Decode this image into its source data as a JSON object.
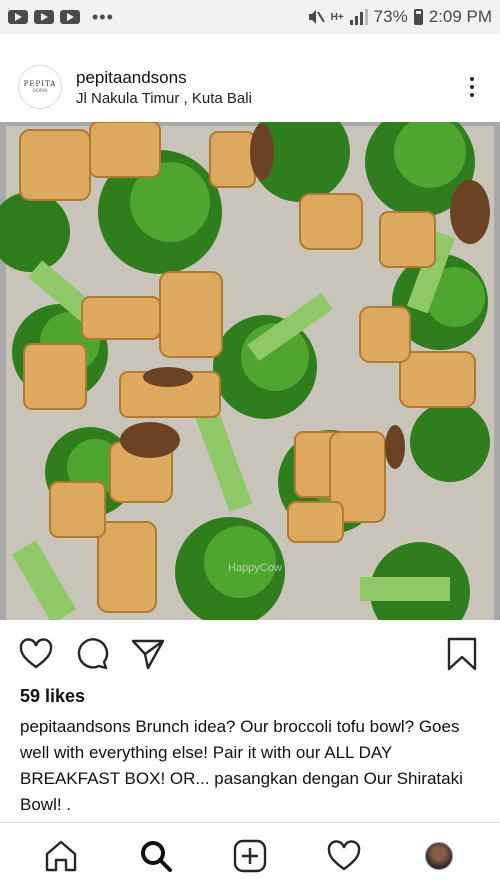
{
  "status_bar": {
    "network": "H+",
    "battery": "73%",
    "time": "2:09 PM"
  },
  "post": {
    "avatar_text": "PEPITA",
    "avatar_subtext": "SONS",
    "username": "pepitaandsons",
    "location": "Jl Nakula Timur , Kuta Bali",
    "watermark": "HappyCow",
    "likes": "59 likes",
    "caption_user": "pepitaandsons",
    "caption_text": "Brunch idea? Our broccoli tofu bowl? Goes well with everything else! Pair it with our ALL DAY BREAKFAST BOX! OR... pasangkan dengan Our Shirataki Bowl! ."
  },
  "nav": {
    "items": [
      "home-icon",
      "search-icon",
      "add-icon",
      "heart-icon",
      "profile-icon"
    ]
  }
}
